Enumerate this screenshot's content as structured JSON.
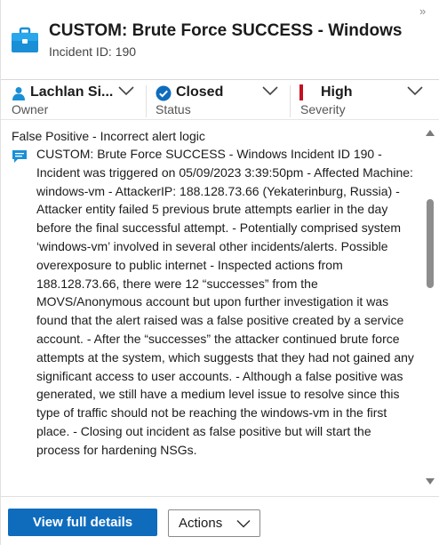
{
  "header": {
    "title": "CUSTOM: Brute Force SUCCESS - Windows",
    "incident_id": "Incident ID: 190",
    "icon": "briefcase-icon",
    "collapse_glyph": "»"
  },
  "properties": {
    "owner": {
      "value": "Lachlan Si...",
      "label": "Owner",
      "icon": "person-icon"
    },
    "status": {
      "value": "Closed",
      "label": "Status",
      "icon": "check-circle-icon"
    },
    "severity": {
      "value": "High",
      "label": "Severity",
      "icon": "severity-bar-icon"
    }
  },
  "content": {
    "classification": "False Positive - Incorrect alert logic",
    "comment": "CUSTOM: Brute Force SUCCESS - Windows Incident ID 190 - Incident was triggered on 05/09/2023 3:39:50pm - Affected Machine: windows-vm - AttackerIP: 188.128.73.66 (Yekaterinburg, Russia) - Attacker entity failed 5 previous brute attempts earlier in the day before the final successful attempt. - Potentially comprised system ‘windows-vm’ involved in several other incidents/alerts. Possible overexposure to public internet - Inspected actions from 188.128.73.66, there were 12 “successes” from the MOVS/Anonymous account but upon further investigation it was found that the alert raised was a false positive created by a service account. - After the “successes” the attacker continued brute force attempts at the system, which suggests that they had not gained any significant access to user accounts. - Although a false positive was generated, we still have a medium level issue to resolve since this type of traffic should not be reaching the windows-vm in the first place. - Closing out incident as false positive but will start the process for hardening NSGs."
  },
  "footer": {
    "view_details_label": "View full details",
    "actions_label": "Actions"
  },
  "colors": {
    "accent": "#0f6cbd",
    "severity_high": "#c50f1f",
    "status_ok": "#0f6cbd"
  }
}
